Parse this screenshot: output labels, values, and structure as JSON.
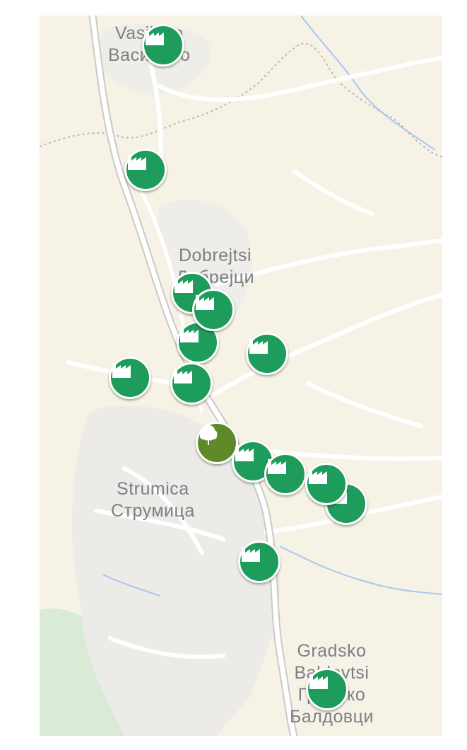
{
  "map": {
    "colors": {
      "land": "#f6f2e6",
      "urban": "#ecebe7",
      "road": "#ffffff",
      "highway_outline": "#c9c9c9",
      "water": "#a9c7f2",
      "forest": "#d9ead7",
      "boundary": "#b9b9b9",
      "label": "#7b7f86",
      "factory_marker": "#1e9c5b",
      "park_marker": "#5f8a2a"
    },
    "places": {
      "vasilevo": {
        "latin": "Vasilevo",
        "cyrillic": "Василево"
      },
      "dobrejtsi": {
        "latin": "Dobrejtsi",
        "cyrillic": "Добрејци"
      },
      "strumica": {
        "latin": "Strumica",
        "cyrillic": "Струмица"
      },
      "gradsko_baldovtsi": {
        "latin1": "Gradsko",
        "latin2": "Baldovtsi",
        "cyrillic1": "Градско",
        "cyrillic2": "Балдовци"
      }
    },
    "markers": [
      {
        "type": "factory",
        "icon": "factory-icon"
      },
      {
        "type": "factory",
        "icon": "factory-icon"
      },
      {
        "type": "factory",
        "icon": "factory-icon"
      },
      {
        "type": "factory",
        "icon": "factory-icon"
      },
      {
        "type": "factory",
        "icon": "factory-icon"
      },
      {
        "type": "factory",
        "icon": "factory-icon"
      },
      {
        "type": "factory",
        "icon": "factory-icon"
      },
      {
        "type": "factory",
        "icon": "factory-icon"
      },
      {
        "type": "park",
        "icon": "tree-icon"
      },
      {
        "type": "factory",
        "icon": "factory-icon"
      },
      {
        "type": "factory",
        "icon": "factory-icon"
      },
      {
        "type": "factory",
        "icon": "factory-icon"
      },
      {
        "type": "factory",
        "icon": "factory-icon"
      },
      {
        "type": "factory",
        "icon": "factory-icon"
      },
      {
        "type": "factory",
        "icon": "factory-icon"
      }
    ]
  }
}
